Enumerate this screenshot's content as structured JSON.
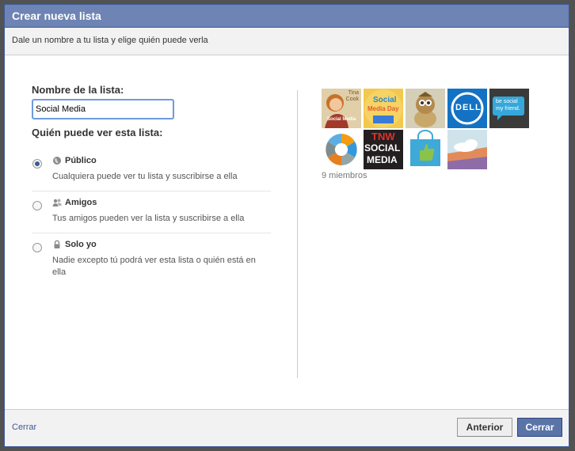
{
  "dialog": {
    "title": "Crear nueva lista",
    "subtitle": "Dale un nombre a tu lista y elige quién puede verla"
  },
  "form": {
    "name_label": "Nombre de la lista:",
    "name_value": "Social Media",
    "who_label": "Quién puede ver esta lista:"
  },
  "privacy": {
    "options": [
      {
        "title": "Público",
        "desc": "Cualquiera puede ver tu lista y suscribirse a ella",
        "icon": "globe-icon",
        "selected": true
      },
      {
        "title": "Amigos",
        "desc": "Tus amigos pueden ver la lista y suscribirse a ella",
        "icon": "friends-icon",
        "selected": false
      },
      {
        "title": "Solo yo",
        "desc": "Nadie excepto tú podrá ver esta lista o quién está en ella",
        "icon": "lock-icon",
        "selected": false
      }
    ]
  },
  "members": {
    "count_text": "9 miembros",
    "thumbnails": [
      {
        "name": "tina-cook",
        "text_1": "Tina",
        "text_2": "Cook",
        "text_3": "Social Media"
      },
      {
        "name": "social-media-day",
        "text_1": "Social",
        "text_2": "Media Day"
      },
      {
        "name": "cartoon-character"
      },
      {
        "name": "dell",
        "text_1": "DELL"
      },
      {
        "name": "be-social",
        "text_1": "be social",
        "text_2": "my friend."
      },
      {
        "name": "colorful-wheel"
      },
      {
        "name": "tnw-social-media",
        "text_1": "TNW",
        "text_2": "SOCIAL",
        "text_3": "MEDIA"
      },
      {
        "name": "thumbs-up-bag"
      },
      {
        "name": "cloud-landscape"
      }
    ]
  },
  "footer": {
    "close_link": "Cerrar",
    "prev_button": "Anterior",
    "close_button": "Cerrar"
  },
  "colors": {
    "titlebar": "#6d84b4",
    "primary": "#3b5998",
    "button_primary": "#5b74a8"
  }
}
